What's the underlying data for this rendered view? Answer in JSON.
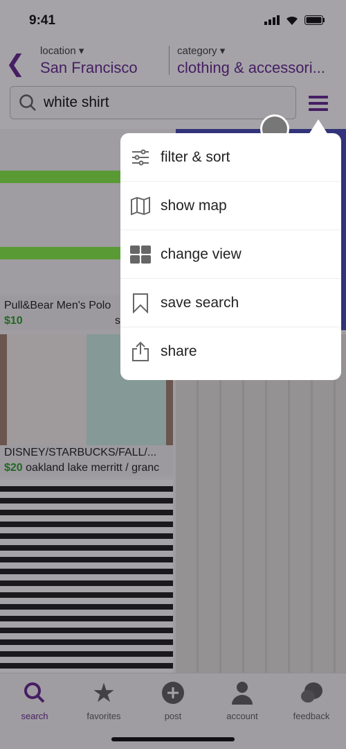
{
  "status": {
    "time": "9:41"
  },
  "header": {
    "location_label": "location ▾",
    "location": "San Francisco",
    "category_label": "category ▾",
    "category": "clothing & accessori..."
  },
  "search": {
    "value": "white shirt"
  },
  "listings": [
    {
      "title": "Pull&Bear Men's Polo",
      "price": "$10",
      "location": "s"
    },
    {
      "title": "DISNEY/STARBUCKS/FALL/...",
      "price": "$20",
      "location": "oakland lake merritt / granc"
    }
  ],
  "menu": {
    "items": [
      {
        "label": "filter & sort",
        "icon": "sliders-icon"
      },
      {
        "label": "show map",
        "icon": "map-icon"
      },
      {
        "label": "change view",
        "icon": "grid-icon"
      },
      {
        "label": "save search",
        "icon": "bookmark-icon"
      },
      {
        "label": "share",
        "icon": "share-icon"
      }
    ]
  },
  "tabs": [
    {
      "label": "search",
      "active": true
    },
    {
      "label": "favorites"
    },
    {
      "label": "post"
    },
    {
      "label": "account"
    },
    {
      "label": "feedback"
    }
  ],
  "colors": {
    "accent": "#5a1a8a",
    "price": "#1f9a1f"
  }
}
